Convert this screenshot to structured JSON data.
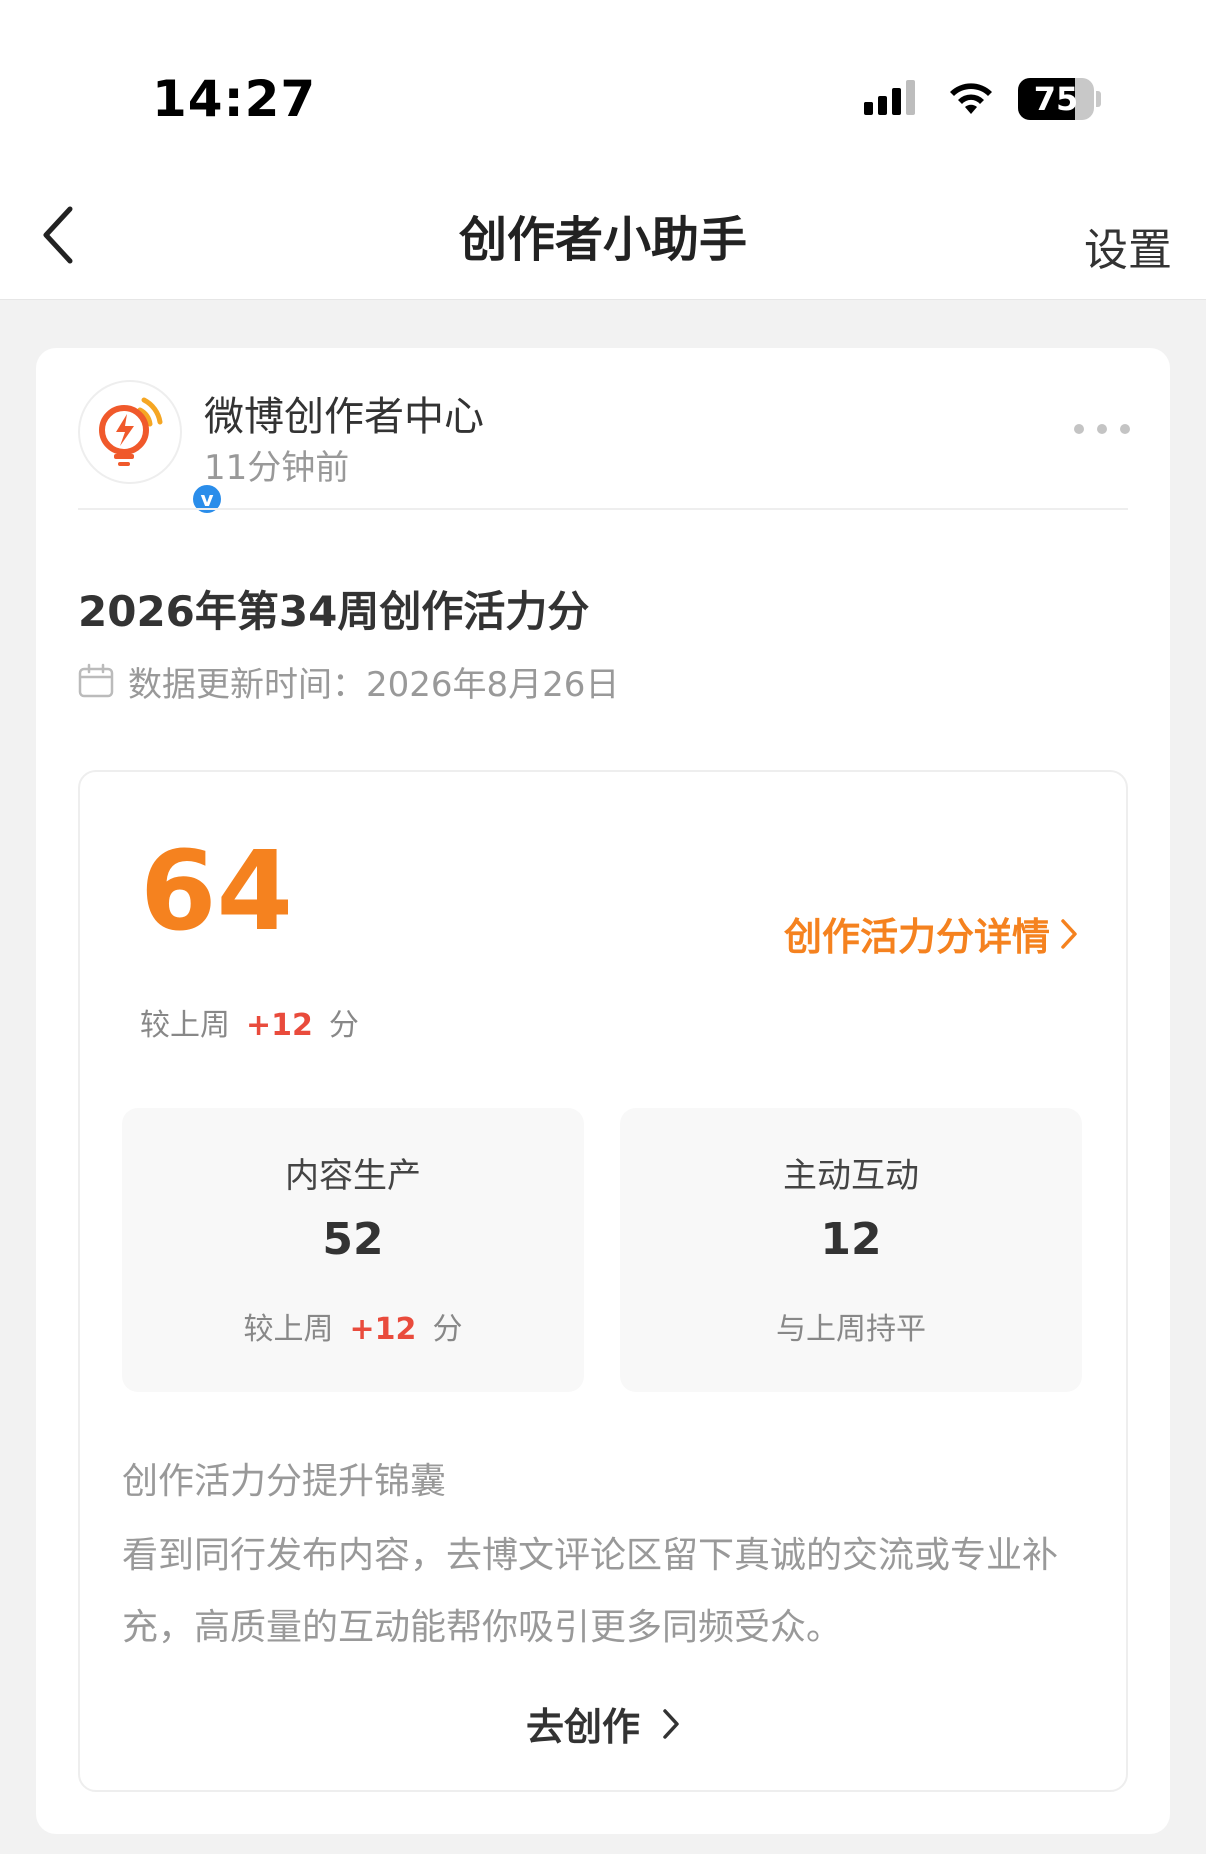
{
  "status_bar": {
    "time": "14:27",
    "battery_level": "75",
    "battery_fraction": 0.75,
    "icons": [
      "cellular-signal-icon",
      "wifi-icon",
      "battery-icon"
    ]
  },
  "nav": {
    "title": "创作者小助手",
    "settings_label": "设置",
    "back_icon": "chevron-left-icon"
  },
  "post": {
    "publisher_name": "微博创作者中心",
    "time_ago": "11分钟前",
    "verified_mark": "v",
    "title": "2026年第34周创作活力分",
    "update_time": "数据更新时间：2026年8月26日"
  },
  "score": {
    "value": "64",
    "detail_link": "创作活力分详情",
    "compare_prefix": "较上周",
    "compare_delta": "+12",
    "compare_suffix": "分"
  },
  "metrics": [
    {
      "label": "内容生产",
      "value": "52",
      "compare_prefix": "较上周",
      "compare_delta": "+12",
      "compare_suffix": "分"
    },
    {
      "label": "主动互动",
      "value": "12",
      "compare_text": "与上周持平"
    }
  ],
  "tips": {
    "title": "创作活力分提升锦囊",
    "body": "看到同行发布内容，去博文评论区留下真诚的交流或专业补充，高质量的互动能帮你吸引更多同频受众。"
  },
  "cta": {
    "label": "去创作"
  },
  "colors": {
    "accent_orange": "#f5821f",
    "delta_red": "#e94b3c",
    "verified_blue": "#2a8dea",
    "page_bg": "#f2f2f2"
  }
}
